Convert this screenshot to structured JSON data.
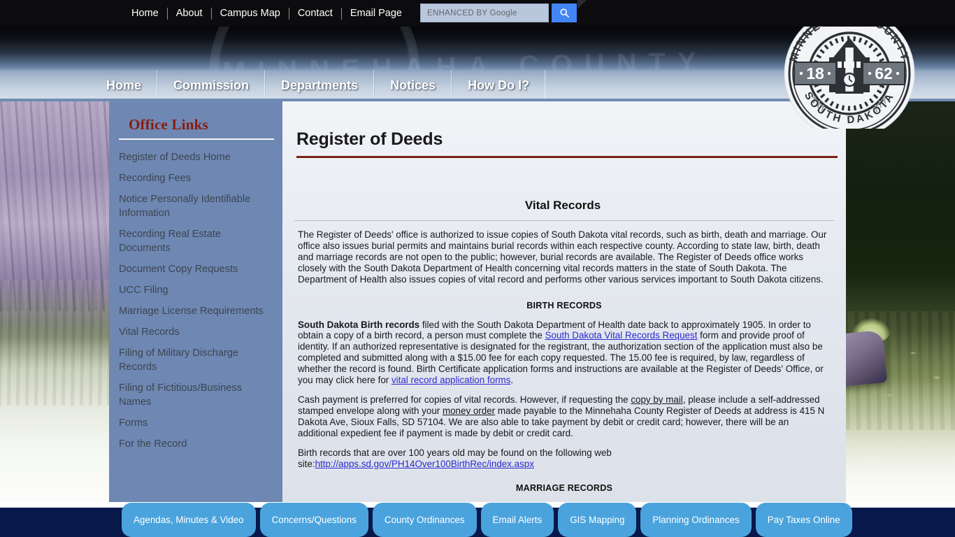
{
  "topbar": {
    "links": [
      {
        "label": "Home"
      },
      {
        "label": "About"
      },
      {
        "label": "Campus Map"
      },
      {
        "label": "Contact"
      },
      {
        "label": "Email Page"
      }
    ],
    "search": {
      "placeholder": "ENHANCED BY Google",
      "value": "",
      "button_icon": "search-icon"
    }
  },
  "banner": {
    "watermark_text": "MINNEHAHA COUNTY",
    "seal": {
      "top_text": "MINNEHAHA COUNTY",
      "bottom_text": "SOUTH DAKOTA",
      "year_left": "18",
      "year_right": "62"
    }
  },
  "mainnav": {
    "items": [
      {
        "label": "Home"
      },
      {
        "label": "Commission"
      },
      {
        "label": "Departments"
      },
      {
        "label": "Notices"
      },
      {
        "label": "How Do I?"
      }
    ]
  },
  "sidebar": {
    "title": "Office Links",
    "items": [
      {
        "label": "Register of Deeds Home"
      },
      {
        "label": "Recording Fees"
      },
      {
        "label": "Notice Personally Identifiable Information"
      },
      {
        "label": "Recording Real Estate Documents"
      },
      {
        "label": "Document Copy Requests"
      },
      {
        "label": "UCC Filing"
      },
      {
        "label": "Marriage License Requirements"
      },
      {
        "label": "Vital Records"
      },
      {
        "label": "Filing of Military Discharge Records"
      },
      {
        "label": "Filing of Fictitious/Business Names"
      },
      {
        "label": "Forms"
      },
      {
        "label": "For the Record"
      }
    ]
  },
  "content": {
    "page_title": "Register of Deeds",
    "section_heading": "Vital Records",
    "intro_paragraph": "The Register of Deeds' office is authorized to issue copies of South Dakota vital records, such as birth, death and marriage.  Our office also issues burial permits and maintains burial records within each respective county.  According to state law, birth, death and marriage records are not open to the public; however, burial records are available.  The Register of Deeds office works closely with the South Dakota Department of Health concerning vital records matters in the state of South Dakota.  The Department of Health also issues copies of vital record and performs other various services important to South Dakota citizens.",
    "birth_heading": "BIRTH RECORDS",
    "birth_p1": {
      "lead_bold": "South Dakota Birth records",
      "part1": " filed with the South Dakota Department of Health date back to approximately 1905. In order to obtain a copy of a birth record, a person must complete the ",
      "link1": "South Dakota Vital Records Request",
      "part2": " form and provide proof of identity. If an authorized representative is designated for the registrant, the authorization section of the application must also be completed and submitted along with a $15.00 fee for each copy requested. The 15.00 fee is required, by law, regardless of whether the record is found. Birth Certificate application forms and instructions are available at the Register of Deeds' Office, or you may click here for ",
      "link2": "vital record application forms",
      "part3": "."
    },
    "birth_p2": {
      "part1": "Cash payment is preferred for copies of vital records. However, if requesting the ",
      "ul1": "copy by mail",
      "part2": ", please include a self-addressed stamped envelope along with your ",
      "ul2": "money order",
      "part3": " made payable to the Minnehaha County Register of Deeds at address is 415 N Dakota Ave, Sioux Falls, SD 57104. We are also able to take payment by debit or credit card; however, there will be an additional expedient fee if payment is made by debit or credit card."
    },
    "birth_p3": {
      "part1": "Birth records that are over 100 years old may be found on the following web site:",
      "link": "http://apps.sd.gov/PH14Over100BirthRec/index.aspx"
    },
    "marriage_heading": "MARRIAGE RECORDS"
  },
  "footer": {
    "buttons": [
      {
        "label": "Agendas, Minutes & Video"
      },
      {
        "label": "Concerns/Questions"
      },
      {
        "label": "County Ordinances"
      },
      {
        "label": "Email Alerts"
      },
      {
        "label": "GIS Mapping"
      },
      {
        "label": "Planning Ordinances"
      },
      {
        "label": "Pay Taxes Online"
      }
    ]
  },
  "colors": {
    "topbar_bg": "#0c0c0e",
    "sidebar_bg": "#6e88b3",
    "sidebar_title": "#8b1a0e",
    "title_rule": "#7a2118",
    "content_bg": "#e4e8ef",
    "footer_bg": "#07184a",
    "footer_button": "#4ba3dd",
    "link": "#2b2bcf",
    "google_blue": "#4285f4"
  }
}
